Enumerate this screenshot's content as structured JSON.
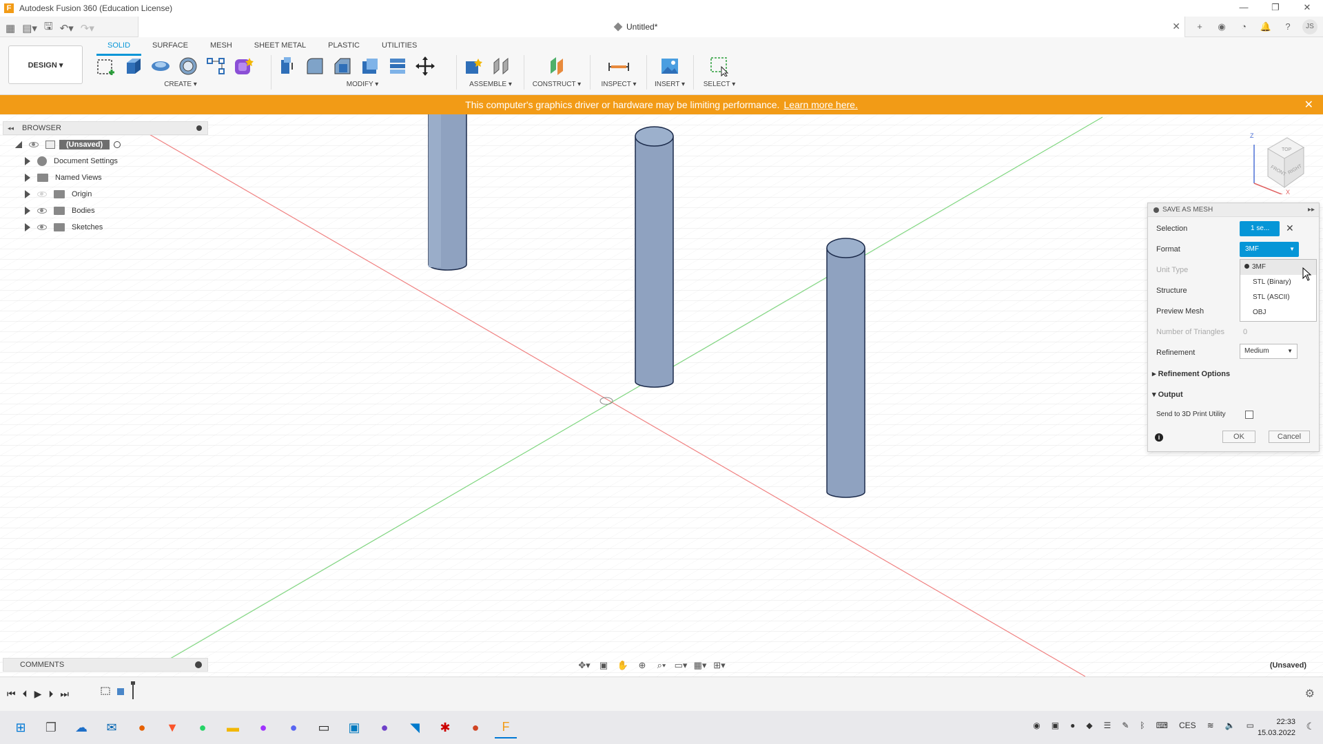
{
  "window": {
    "title": "Autodesk Fusion 360 (Education License)",
    "controls": [
      "—",
      "❐",
      "✕"
    ]
  },
  "document": {
    "title": "Untitled*",
    "close": "✕"
  },
  "user": {
    "initials": "JS"
  },
  "toolbar": {
    "workspace": "DESIGN ▾",
    "tabs": [
      "SOLID",
      "SURFACE",
      "MESH",
      "SHEET METAL",
      "PLASTIC",
      "UTILITIES"
    ],
    "active_tab": "SOLID",
    "groups": {
      "create": "CREATE ▾",
      "modify": "MODIFY ▾",
      "assemble": "ASSEMBLE ▾",
      "construct": "CONSTRUCT ▾",
      "inspect": "INSPECT ▾",
      "insert": "INSERT ▾",
      "select": "SELECT ▾"
    }
  },
  "warning": {
    "text": "This computer's graphics driver or hardware may be limiting performance.",
    "link": "Learn more here.",
    "close": "✕"
  },
  "browser": {
    "header": "BROWSER",
    "root": "(Unsaved)",
    "items": [
      {
        "label": "Document Settings"
      },
      {
        "label": "Named Views"
      },
      {
        "label": "Origin"
      },
      {
        "label": "Bodies"
      },
      {
        "label": "Sketches"
      }
    ]
  },
  "comments": {
    "header": "COMMENTS"
  },
  "viewcube": {
    "faces": [
      "TOP",
      "FRONT",
      "RIGHT"
    ],
    "axes": [
      "Z",
      "X"
    ]
  },
  "dialog": {
    "title": "SAVE AS MESH",
    "selection_label": "Selection",
    "selection_value": "1 se...",
    "format_label": "Format",
    "format_value": "3MF",
    "format_options": [
      "3MF",
      "STL (Binary)",
      "STL (ASCII)",
      "OBJ"
    ],
    "unit_type_label": "Unit Type",
    "structure_label": "Structure",
    "preview_mesh_label": "Preview Mesh",
    "triangles_label": "Number of Triangles",
    "triangles_value": "0",
    "refinement_label": "Refinement",
    "refinement_value": "Medium",
    "refinement_options_label": "Refinement Options",
    "output_label": "Output",
    "send_label": "Send to 3D Print Utility",
    "ok": "OK",
    "cancel": "Cancel"
  },
  "status": {
    "unsaved": "(Unsaved)"
  },
  "taskbar": {
    "language": "CES",
    "time": "22:33",
    "date": "15.03.2022"
  },
  "colors": {
    "accent": "#0696d7",
    "warning": "#f29b16",
    "body": "#8fa2c0",
    "body_edge": "#1b2a4a",
    "x_axis": "#f08080",
    "y_axis": "#7fd67f"
  }
}
